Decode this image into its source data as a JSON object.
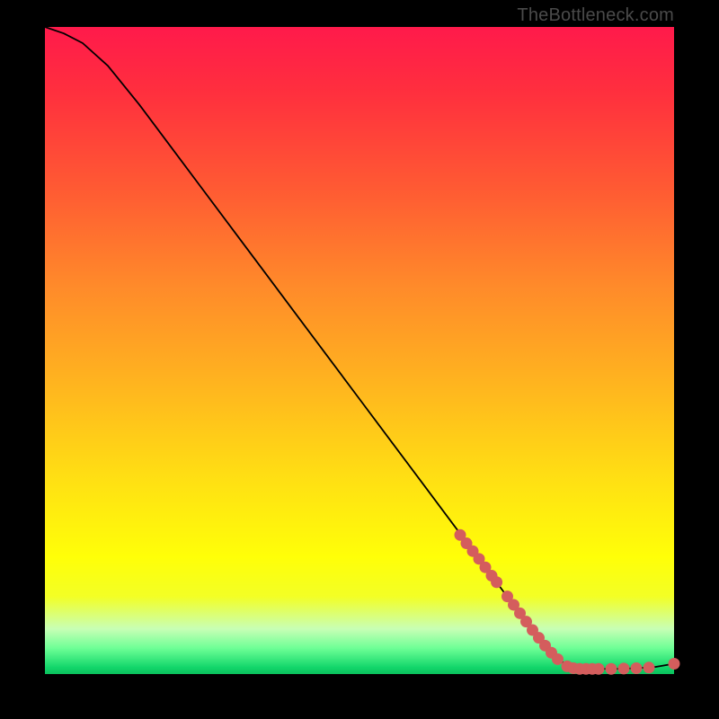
{
  "watermark": "TheBottleneck.com",
  "colors": {
    "curve_stroke": "#000000",
    "marker_fill": "#d45d5d",
    "marker_stroke": "#c24e4e",
    "background": "#000000"
  },
  "chart_data": {
    "type": "line",
    "title": "",
    "xlabel": "",
    "ylabel": "",
    "xlim": [
      0,
      100
    ],
    "ylim": [
      0,
      100
    ],
    "note": "Axes are unlabeled in source; values are normalized 0–100 read from visual gridless estimate.",
    "curve": [
      {
        "x": 0,
        "y": 100
      },
      {
        "x": 3,
        "y": 99
      },
      {
        "x": 6,
        "y": 97.5
      },
      {
        "x": 10,
        "y": 94
      },
      {
        "x": 15,
        "y": 88
      },
      {
        "x": 20,
        "y": 81.5
      },
      {
        "x": 25,
        "y": 75
      },
      {
        "x": 30,
        "y": 68.5
      },
      {
        "x": 35,
        "y": 62
      },
      {
        "x": 40,
        "y": 55.5
      },
      {
        "x": 45,
        "y": 49
      },
      {
        "x": 50,
        "y": 42.5
      },
      {
        "x": 55,
        "y": 36
      },
      {
        "x": 60,
        "y": 29.5
      },
      {
        "x": 65,
        "y": 23
      },
      {
        "x": 70,
        "y": 16.5
      },
      {
        "x": 75,
        "y": 10
      },
      {
        "x": 80,
        "y": 4
      },
      {
        "x": 83,
        "y": 1.2
      },
      {
        "x": 85,
        "y": 0.8
      },
      {
        "x": 88,
        "y": 0.8
      },
      {
        "x": 91,
        "y": 0.8
      },
      {
        "x": 94,
        "y": 0.9
      },
      {
        "x": 97,
        "y": 1.1
      },
      {
        "x": 100,
        "y": 1.6
      }
    ],
    "markers": [
      {
        "x": 66,
        "y": 21.5
      },
      {
        "x": 67,
        "y": 20.2
      },
      {
        "x": 68,
        "y": 19.0
      },
      {
        "x": 69,
        "y": 17.8
      },
      {
        "x": 70,
        "y": 16.5
      },
      {
        "x": 71,
        "y": 15.2
      },
      {
        "x": 71.8,
        "y": 14.2
      },
      {
        "x": 73.5,
        "y": 12.0
      },
      {
        "x": 74.5,
        "y": 10.7
      },
      {
        "x": 75.5,
        "y": 9.4
      },
      {
        "x": 76.5,
        "y": 8.1
      },
      {
        "x": 77.5,
        "y": 6.8
      },
      {
        "x": 78.5,
        "y": 5.6
      },
      {
        "x": 79.5,
        "y": 4.4
      },
      {
        "x": 80.5,
        "y": 3.3
      },
      {
        "x": 81.5,
        "y": 2.3
      },
      {
        "x": 83,
        "y": 1.2
      },
      {
        "x": 84,
        "y": 0.9
      },
      {
        "x": 85,
        "y": 0.8
      },
      {
        "x": 86,
        "y": 0.8
      },
      {
        "x": 87,
        "y": 0.8
      },
      {
        "x": 88,
        "y": 0.8
      },
      {
        "x": 90,
        "y": 0.8
      },
      {
        "x": 92,
        "y": 0.85
      },
      {
        "x": 94,
        "y": 0.9
      },
      {
        "x": 96,
        "y": 1.0
      },
      {
        "x": 100,
        "y": 1.6
      }
    ]
  }
}
